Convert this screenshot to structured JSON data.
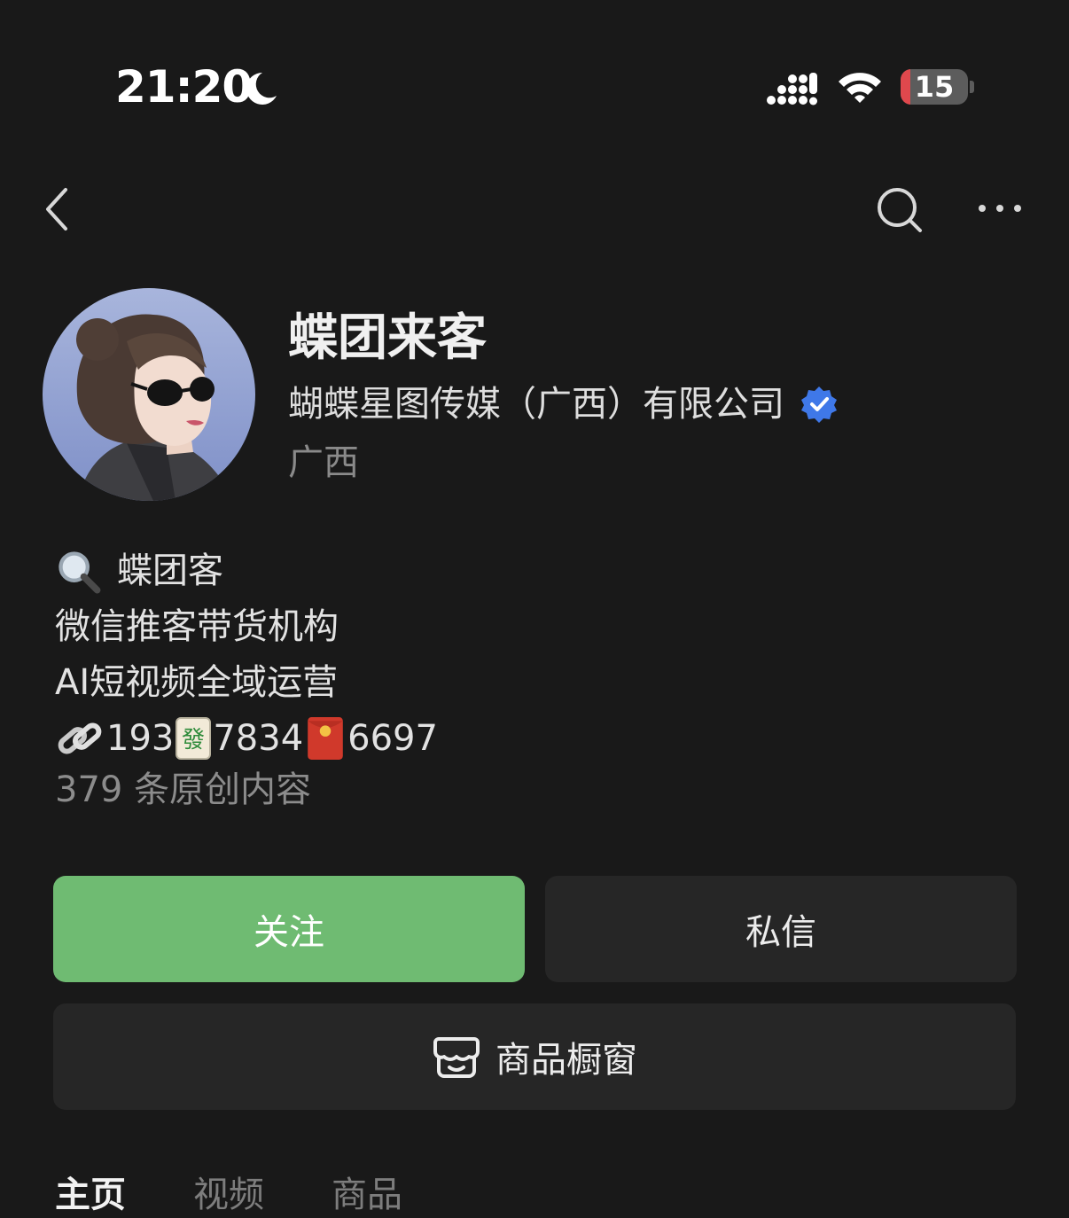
{
  "status_bar": {
    "time": "21:20",
    "battery": "15",
    "battery_level": 0.15
  },
  "profile": {
    "name": "蝶团来客",
    "company": "蝴蝶星图传媒（广西）有限公司",
    "region": "广西"
  },
  "bio": {
    "line1": "蝶团客",
    "line2": "微信推客带货机构",
    "line3": "AI短视频全域运营",
    "contact": {
      "part1": "193",
      "part2": "7834",
      "part3": "6697"
    },
    "stats": "379 条原创内容"
  },
  "buttons": {
    "follow": "关注",
    "message": "私信",
    "shop": "商品橱窗"
  },
  "tabs": [
    "主页",
    "视频",
    "商品"
  ],
  "colors": {
    "follow_green": "#6fbb72",
    "verified_blue": "#3f78e8",
    "battery_red": "#e0484d"
  },
  "icons": [
    "back-icon",
    "search-icon",
    "more-icon",
    "verified-icon",
    "magnifier-emoji-icon",
    "link-emoji-icon",
    "mahjong-emoji-icon",
    "red-envelope-emoji-icon",
    "shop-window-icon",
    "moon-icon",
    "signal-icon",
    "wifi-icon",
    "battery-icon"
  ]
}
